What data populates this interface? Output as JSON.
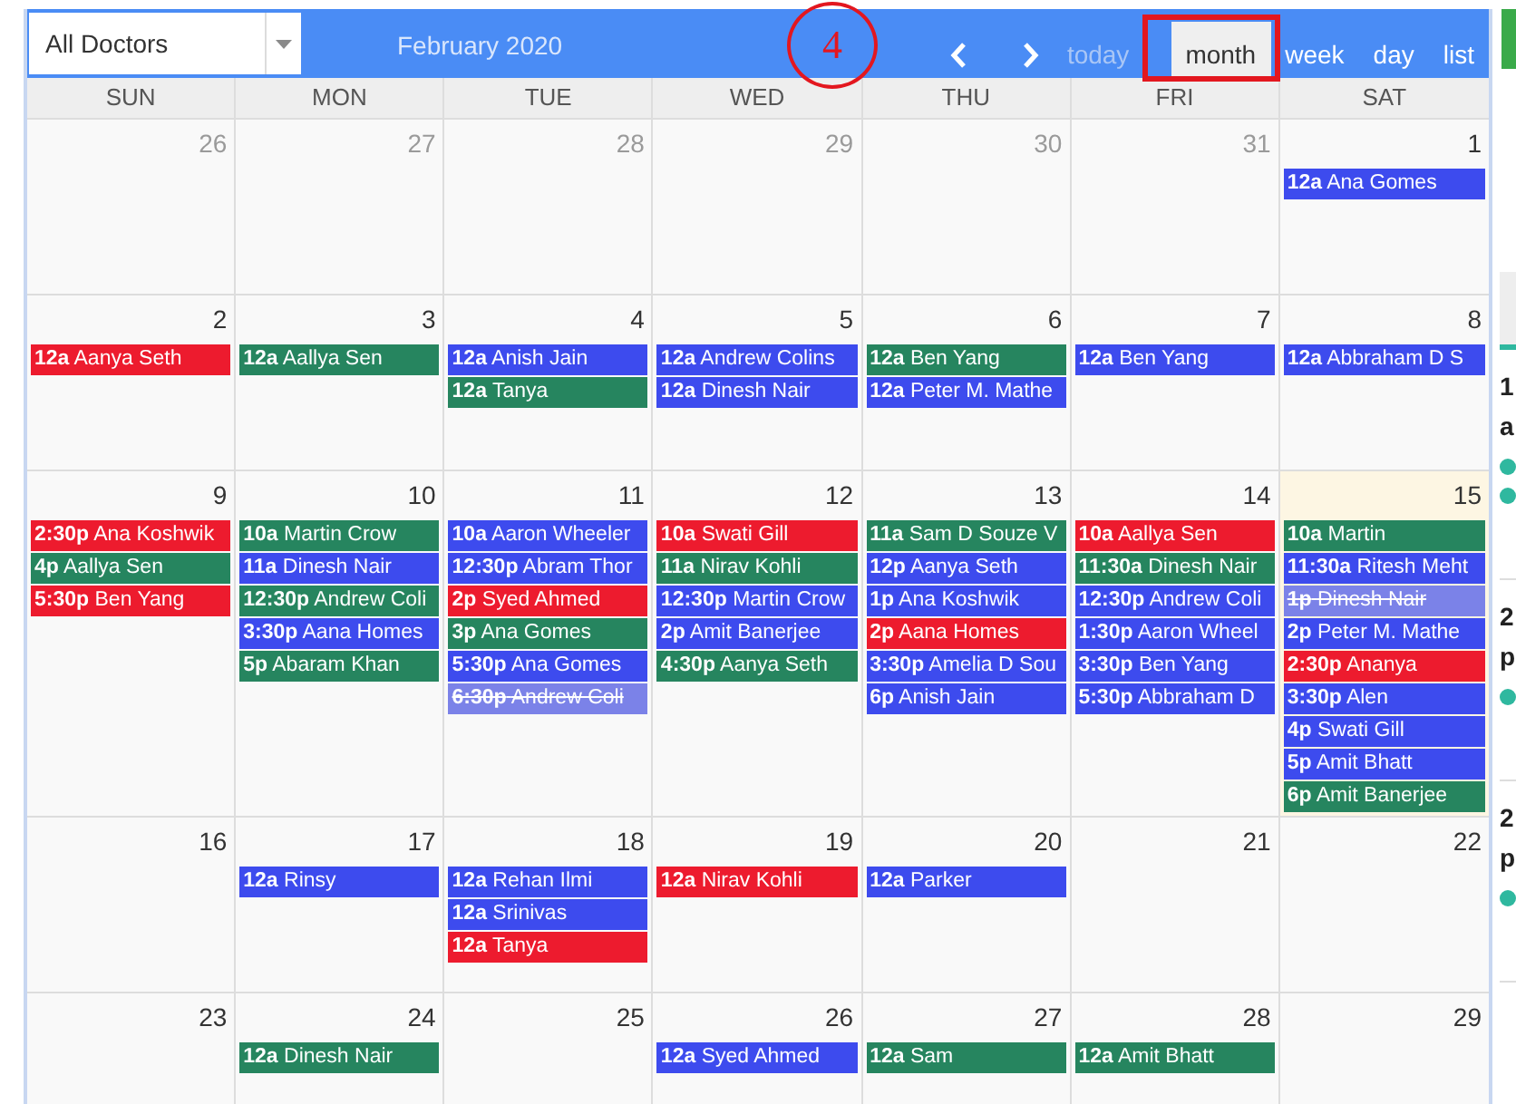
{
  "filter": {
    "value": "All Doctors"
  },
  "title": "February 2020",
  "step_marker": {
    "label": "4"
  },
  "today_button": {
    "label": "today",
    "disabled": true
  },
  "views": [
    {
      "label": "month",
      "selected": true,
      "highlighted": true
    },
    {
      "label": "week",
      "selected": false,
      "highlighted": false
    },
    {
      "label": "day",
      "selected": false,
      "highlighted": false
    },
    {
      "label": "list",
      "selected": false,
      "highlighted": false
    }
  ],
  "weekdays": [
    "SUN",
    "MON",
    "TUE",
    "WED",
    "THU",
    "FRI",
    "SAT"
  ],
  "weeks": [
    {
      "days": [
        {
          "number": "26",
          "other_month": true,
          "today": false
        },
        {
          "number": "27",
          "other_month": true,
          "today": false
        },
        {
          "number": "28",
          "other_month": true,
          "today": false
        },
        {
          "number": "29",
          "other_month": true,
          "today": false
        },
        {
          "number": "30",
          "other_month": true,
          "today": false
        },
        {
          "number": "31",
          "other_month": true,
          "today": false
        },
        {
          "number": "1",
          "other_month": false,
          "today": false,
          "events": [
            {
              "time": "12a",
              "name": "Ana Gomes",
              "color": "#3d4bee",
              "cancelled": false
            }
          ]
        }
      ]
    },
    {
      "days": [
        {
          "number": "2",
          "other_month": false,
          "today": false,
          "events": [
            {
              "time": "12a",
              "name": "Aanya Seth",
              "color": "#ed1b2e",
              "cancelled": false
            }
          ]
        },
        {
          "number": "3",
          "other_month": false,
          "today": false,
          "events": [
            {
              "time": "12a",
              "name": "Aallya Sen",
              "color": "#26855f",
              "cancelled": false
            }
          ]
        },
        {
          "number": "4",
          "other_month": false,
          "today": false,
          "events": [
            {
              "time": "12a",
              "name": "Anish Jain",
              "color": "#3d4bee",
              "cancelled": false
            },
            {
              "time": "12a",
              "name": "Tanya",
              "color": "#26855f",
              "cancelled": false
            }
          ]
        },
        {
          "number": "5",
          "other_month": false,
          "today": false,
          "events": [
            {
              "time": "12a",
              "name": "Andrew Colins",
              "color": "#3d4bee",
              "cancelled": false
            },
            {
              "time": "12a",
              "name": "Dinesh Nair",
              "color": "#3d4bee",
              "cancelled": false
            }
          ]
        },
        {
          "number": "6",
          "other_month": false,
          "today": false,
          "events": [
            {
              "time": "12a",
              "name": "Ben Yang",
              "color": "#26855f",
              "cancelled": false
            },
            {
              "time": "12a",
              "name": "Peter M. Mathe",
              "color": "#3d4bee",
              "cancelled": false
            }
          ]
        },
        {
          "number": "7",
          "other_month": false,
          "today": false,
          "events": [
            {
              "time": "12a",
              "name": "Ben Yang",
              "color": "#3d4bee",
              "cancelled": false
            }
          ]
        },
        {
          "number": "8",
          "other_month": false,
          "today": false,
          "events": [
            {
              "time": "12a",
              "name": "Abbraham D S",
              "color": "#3d4bee",
              "cancelled": false
            }
          ]
        }
      ]
    },
    {
      "days": [
        {
          "number": "9",
          "other_month": false,
          "today": false,
          "events": [
            {
              "time": "2:30p",
              "name": "Ana Koshwik",
              "color": "#ed1b2e",
              "cancelled": false
            },
            {
              "time": "4p",
              "name": "Aallya Sen",
              "color": "#26855f",
              "cancelled": false
            },
            {
              "time": "5:30p",
              "name": "Ben Yang",
              "color": "#ed1b2e",
              "cancelled": false
            }
          ]
        },
        {
          "number": "10",
          "other_month": false,
          "today": false,
          "events": [
            {
              "time": "10a",
              "name": "Martin Crow",
              "color": "#26855f",
              "cancelled": false
            },
            {
              "time": "11a",
              "name": "Dinesh Nair",
              "color": "#3d4bee",
              "cancelled": false
            },
            {
              "time": "12:30p",
              "name": "Andrew Coli",
              "color": "#26855f",
              "cancelled": false
            },
            {
              "time": "3:30p",
              "name": "Aana Homes",
              "color": "#3d4bee",
              "cancelled": false
            },
            {
              "time": "5p",
              "name": "Abaram Khan",
              "color": "#26855f",
              "cancelled": false
            }
          ]
        },
        {
          "number": "11",
          "other_month": false,
          "today": false,
          "events": [
            {
              "time": "10a",
              "name": "Aaron Wheeler",
              "color": "#3d4bee",
              "cancelled": false
            },
            {
              "time": "12:30p",
              "name": "Abram Thor",
              "color": "#3d4bee",
              "cancelled": false
            },
            {
              "time": "2p",
              "name": "Syed Ahmed",
              "color": "#ed1b2e",
              "cancelled": false
            },
            {
              "time": "3p",
              "name": "Ana Gomes",
              "color": "#26855f",
              "cancelled": false
            },
            {
              "time": "5:30p",
              "name": "Ana Gomes",
              "color": "#3d4bee",
              "cancelled": false
            },
            {
              "time": "6:30p",
              "name": "Andrew Coli",
              "color": "#7b82e8",
              "cancelled": true
            }
          ]
        },
        {
          "number": "12",
          "other_month": false,
          "today": false,
          "events": [
            {
              "time": "10a",
              "name": "Swati Gill",
              "color": "#ed1b2e",
              "cancelled": false
            },
            {
              "time": "11a",
              "name": "Nirav Kohli",
              "color": "#26855f",
              "cancelled": false
            },
            {
              "time": "12:30p",
              "name": "Martin Crow",
              "color": "#3d4bee",
              "cancelled": false
            },
            {
              "time": "2p",
              "name": "Amit Banerjee",
              "color": "#3d4bee",
              "cancelled": false
            },
            {
              "time": "4:30p",
              "name": "Aanya Seth",
              "color": "#26855f",
              "cancelled": false
            }
          ]
        },
        {
          "number": "13",
          "other_month": false,
          "today": false,
          "events": [
            {
              "time": "11a",
              "name": "Sam D Souze V",
              "color": "#26855f",
              "cancelled": false
            },
            {
              "time": "12p",
              "name": "Aanya Seth",
              "color": "#3d4bee",
              "cancelled": false
            },
            {
              "time": "1p",
              "name": "Ana Koshwik",
              "color": "#3d4bee",
              "cancelled": false
            },
            {
              "time": "2p",
              "name": "Aana Homes",
              "color": "#ed1b2e",
              "cancelled": false
            },
            {
              "time": "3:30p",
              "name": "Amelia D Sou",
              "color": "#3d4bee",
              "cancelled": false
            },
            {
              "time": "6p",
              "name": "Anish Jain",
              "color": "#3d4bee",
              "cancelled": false
            }
          ]
        },
        {
          "number": "14",
          "other_month": false,
          "today": false,
          "events": [
            {
              "time": "10a",
              "name": "Aallya Sen",
              "color": "#ed1b2e",
              "cancelled": false
            },
            {
              "time": "11:30a",
              "name": "Dinesh Nair",
              "color": "#26855f",
              "cancelled": false
            },
            {
              "time": "12:30p",
              "name": "Andrew Coli",
              "color": "#3d4bee",
              "cancelled": false
            },
            {
              "time": "1:30p",
              "name": "Aaron Wheel",
              "color": "#3d4bee",
              "cancelled": false
            },
            {
              "time": "3:30p",
              "name": "Ben Yang",
              "color": "#3d4bee",
              "cancelled": false
            },
            {
              "time": "5:30p",
              "name": "Abbraham D",
              "color": "#3d4bee",
              "cancelled": false
            }
          ]
        },
        {
          "number": "15",
          "other_month": false,
          "today": true,
          "events": [
            {
              "time": "10a",
              "name": "Martin",
              "color": "#26855f",
              "cancelled": false
            },
            {
              "time": "11:30a",
              "name": "Ritesh Meht",
              "color": "#3d4bee",
              "cancelled": false
            },
            {
              "time": "1p",
              "name": "Dinesh Nair",
              "color": "#7b82e8",
              "cancelled": true
            },
            {
              "time": "2p",
              "name": "Peter M. Mathe",
              "color": "#3d4bee",
              "cancelled": false
            },
            {
              "time": "2:30p",
              "name": "Ananya",
              "color": "#ed1b2e",
              "cancelled": false
            },
            {
              "time": "3:30p",
              "name": "Alen",
              "color": "#3d4bee",
              "cancelled": false
            },
            {
              "time": "4p",
              "name": "Swati Gill",
              "color": "#3d4bee",
              "cancelled": false
            },
            {
              "time": "5p",
              "name": "Amit Bhatt",
              "color": "#3d4bee",
              "cancelled": false
            },
            {
              "time": "6p",
              "name": "Amit Banerjee",
              "color": "#26855f",
              "cancelled": false
            }
          ]
        }
      ]
    },
    {
      "days": [
        {
          "number": "16",
          "other_month": false,
          "today": false
        },
        {
          "number": "17",
          "other_month": false,
          "today": false,
          "events": [
            {
              "time": "12a",
              "name": "Rinsy",
              "color": "#3d4bee",
              "cancelled": false
            }
          ]
        },
        {
          "number": "18",
          "other_month": false,
          "today": false,
          "events": [
            {
              "time": "12a",
              "name": "Rehan Ilmi",
              "color": "#3d4bee",
              "cancelled": false
            },
            {
              "time": "12a",
              "name": "Srinivas",
              "color": "#3d4bee",
              "cancelled": false
            },
            {
              "time": "12a",
              "name": "Tanya",
              "color": "#ed1b2e",
              "cancelled": false
            }
          ]
        },
        {
          "number": "19",
          "other_month": false,
          "today": false,
          "events": [
            {
              "time": "12a",
              "name": "Nirav Kohli",
              "color": "#ed1b2e",
              "cancelled": false
            }
          ]
        },
        {
          "number": "20",
          "other_month": false,
          "today": false,
          "events": [
            {
              "time": "12a",
              "name": "Parker",
              "color": "#3d4bee",
              "cancelled": false
            }
          ]
        },
        {
          "number": "21",
          "other_month": false,
          "today": false
        },
        {
          "number": "22",
          "other_month": false,
          "today": false
        }
      ]
    },
    {
      "days": [
        {
          "number": "23",
          "other_month": false,
          "today": false
        },
        {
          "number": "24",
          "other_month": false,
          "today": false,
          "events": [
            {
              "time": "12a",
              "name": "Dinesh Nair",
              "color": "#26855f",
              "cancelled": false
            }
          ]
        },
        {
          "number": "25",
          "other_month": false,
          "today": false
        },
        {
          "number": "26",
          "other_month": false,
          "today": false,
          "events": [
            {
              "time": "12a",
              "name": "Syed Ahmed",
              "color": "#3d4bee",
              "cancelled": false
            }
          ]
        },
        {
          "number": "27",
          "other_month": false,
          "today": false,
          "events": [
            {
              "time": "12a",
              "name": "Sam",
              "color": "#26855f",
              "cancelled": false
            }
          ]
        },
        {
          "number": "28",
          "other_month": false,
          "today": false,
          "events": [
            {
              "time": "12a",
              "name": "Amit Bhatt",
              "color": "#26855f",
              "cancelled": false
            }
          ]
        },
        {
          "number": "29",
          "other_month": false,
          "today": false
        }
      ]
    }
  ],
  "sidebar": {
    "items": [
      {
        "lines": [
          "1",
          "a"
        ],
        "statuses": [
          {
            "color": "#2fb89f"
          },
          {
            "color": "#2fb89f"
          }
        ]
      },
      {
        "lines": [
          "2",
          "p"
        ],
        "statuses": [
          {
            "color": "#2fb89f"
          }
        ]
      },
      {
        "lines": [
          "2",
          "p"
        ],
        "statuses": [
          {
            "color": "#2fb89f"
          }
        ]
      }
    ]
  }
}
